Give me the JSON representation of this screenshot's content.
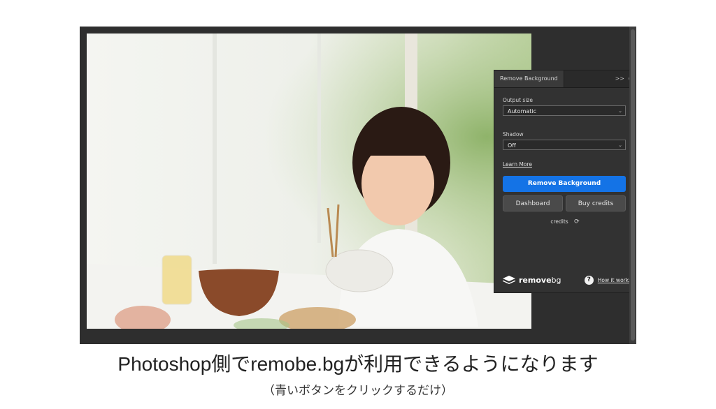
{
  "panel": {
    "tab_title": "Remove Background",
    "controls": {
      "expand": ">>",
      "menu": "≡"
    },
    "output_size": {
      "label": "Output size",
      "value": "Automatic"
    },
    "shadow": {
      "label": "Shadow",
      "value": "Off"
    },
    "learn_more": "Learn More",
    "remove_button": "Remove Background",
    "dashboard_button": "Dashboard",
    "buy_credits_button": "Buy credits",
    "credits_label": "credits",
    "logo": {
      "bold": "remove",
      "light": "bg"
    },
    "how_it_works": "How it works",
    "colors": {
      "accent": "#1473e6",
      "panel_bg": "#323232",
      "app_bg": "#2e2e2e"
    }
  },
  "caption": {
    "main": "Photoshop側でremobe.bgが利用できるようになります",
    "sub": "（青いボタンをクリックするだけ）"
  }
}
